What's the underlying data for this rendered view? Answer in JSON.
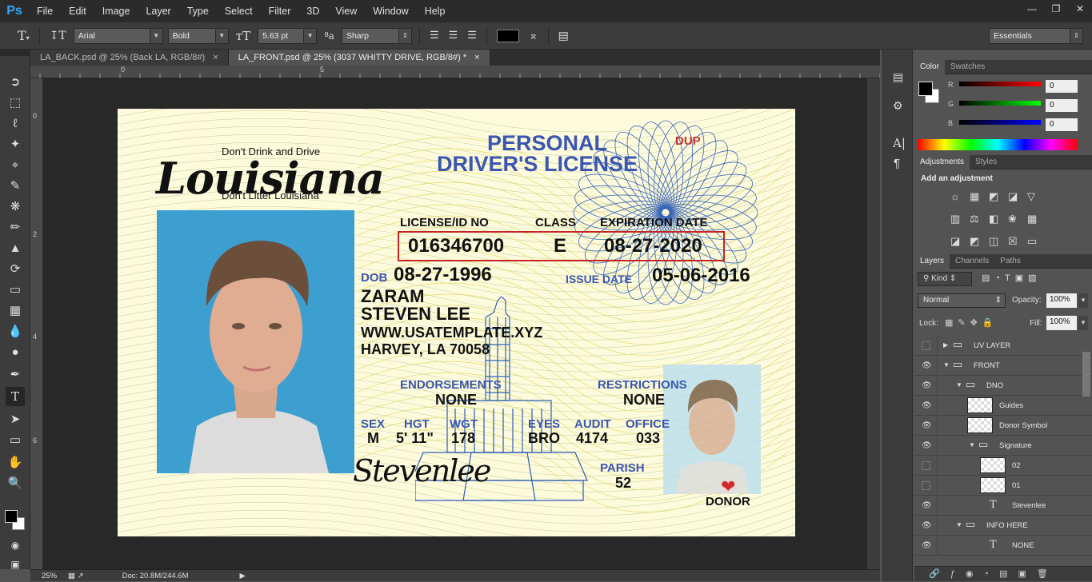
{
  "app": {
    "logo": "Ps"
  },
  "menu": [
    "File",
    "Edit",
    "Image",
    "Layer",
    "Type",
    "Select",
    "Filter",
    "3D",
    "View",
    "Window",
    "Help"
  ],
  "options": {
    "font_family": "Arial",
    "font_style": "Bold",
    "font_size": "5.63 pt",
    "aa_label": "ªa",
    "antialias": "Sharp",
    "workspace": "Essentials",
    "text_color": "#000000"
  },
  "tabs": [
    {
      "label": "LA_BACK.psd @ 25% (Back LA, RGB/8#)"
    },
    {
      "label": "LA_FRONT.psd @ 25% (3037 WHITTY DRIVE, RGB/8#) *"
    }
  ],
  "rulers": {
    "top_ticks": [
      "0",
      "5"
    ],
    "left_ticks": [
      "0",
      "2",
      "4",
      "6"
    ]
  },
  "status": {
    "zoom": "25%",
    "doc": "Doc: 20.8M/244.6M"
  },
  "card": {
    "slogan_top": "Don't Drink and Drive",
    "state": "Louisiana",
    "slogan_bottom": "Don't Litter Louisiana",
    "title_1": "PERSONAL",
    "title_2": "DRIVER'S LICENSE",
    "dup": "DUP",
    "license_label": "LICENSE/ID NO",
    "class_label": "CLASS",
    "exp_label": "EXPIRATION DATE",
    "license_no": "016346700",
    "class": "E",
    "exp_date": "08-27-2020",
    "dob_label": "DOB",
    "dob": "08-27-1996",
    "issue_label": "ISSUE DATE",
    "issue_date": "05-06-2016",
    "last_name": "ZARAM",
    "first_name": "STEVEN LEE",
    "address_1": "WWW.USATEMPLATE.XYZ",
    "address_2": "HARVEY, LA 70058",
    "endorse_label": "ENDORSEMENTS",
    "endorse": "NONE",
    "restrict_label": "RESTRICTIONS",
    "restrict": "NONE",
    "sex_label": "SEX",
    "sex": "M",
    "hgt_label": "HGT",
    "hgt": "5' 11\"",
    "wgt_label": "WGT",
    "wgt": "178",
    "eyes_label": "EYES",
    "eyes": "BRO",
    "audit_label": "AUDIT",
    "audit": "4174",
    "office_label": "OFFICE",
    "office": "033",
    "parish_label": "PARISH",
    "parish": "52",
    "signature": "Stevenlee",
    "donor": "DONOR"
  },
  "color_panel": {
    "tabs": [
      "Color",
      "Swatches"
    ],
    "r_label": "R",
    "g_label": "G",
    "b_label": "B",
    "r": "0",
    "g": "0",
    "b": "0"
  },
  "adjust_panel": {
    "tabs": [
      "Adjustments",
      "Styles"
    ],
    "title": "Add an adjustment"
  },
  "layers_panel": {
    "tabs": [
      "Layers",
      "Channels",
      "Paths"
    ],
    "kind": "Kind",
    "blend": "Normal",
    "opacity_label": "Opacity:",
    "opacity": "100%",
    "lock_label": "Lock:",
    "fill_label": "Fill:",
    "fill": "100%",
    "layers": [
      {
        "name": "UV LAYER",
        "type": "group",
        "indent": 0,
        "visible": false,
        "open": false
      },
      {
        "name": "FRONT",
        "type": "group",
        "indent": 0,
        "visible": true,
        "open": true
      },
      {
        "name": "DNO",
        "type": "group",
        "indent": 1,
        "visible": true,
        "open": true
      },
      {
        "name": "Guides",
        "type": "pixel",
        "indent": 1,
        "visible": true
      },
      {
        "name": "Donor Symbol",
        "type": "pixel",
        "indent": 1,
        "visible": true
      },
      {
        "name": "Signature",
        "type": "group",
        "indent": 2,
        "visible": true,
        "open": true
      },
      {
        "name": "02",
        "type": "pixel",
        "indent": 2,
        "visible": false
      },
      {
        "name": "01",
        "type": "pixel",
        "indent": 2,
        "visible": false
      },
      {
        "name": "Stevenlee",
        "type": "text",
        "indent": 1,
        "visible": true
      },
      {
        "name": "INFO HERE",
        "type": "group",
        "indent": 1,
        "visible": true,
        "open": true
      },
      {
        "name": "NONE",
        "type": "text",
        "indent": 1,
        "visible": true
      }
    ]
  }
}
